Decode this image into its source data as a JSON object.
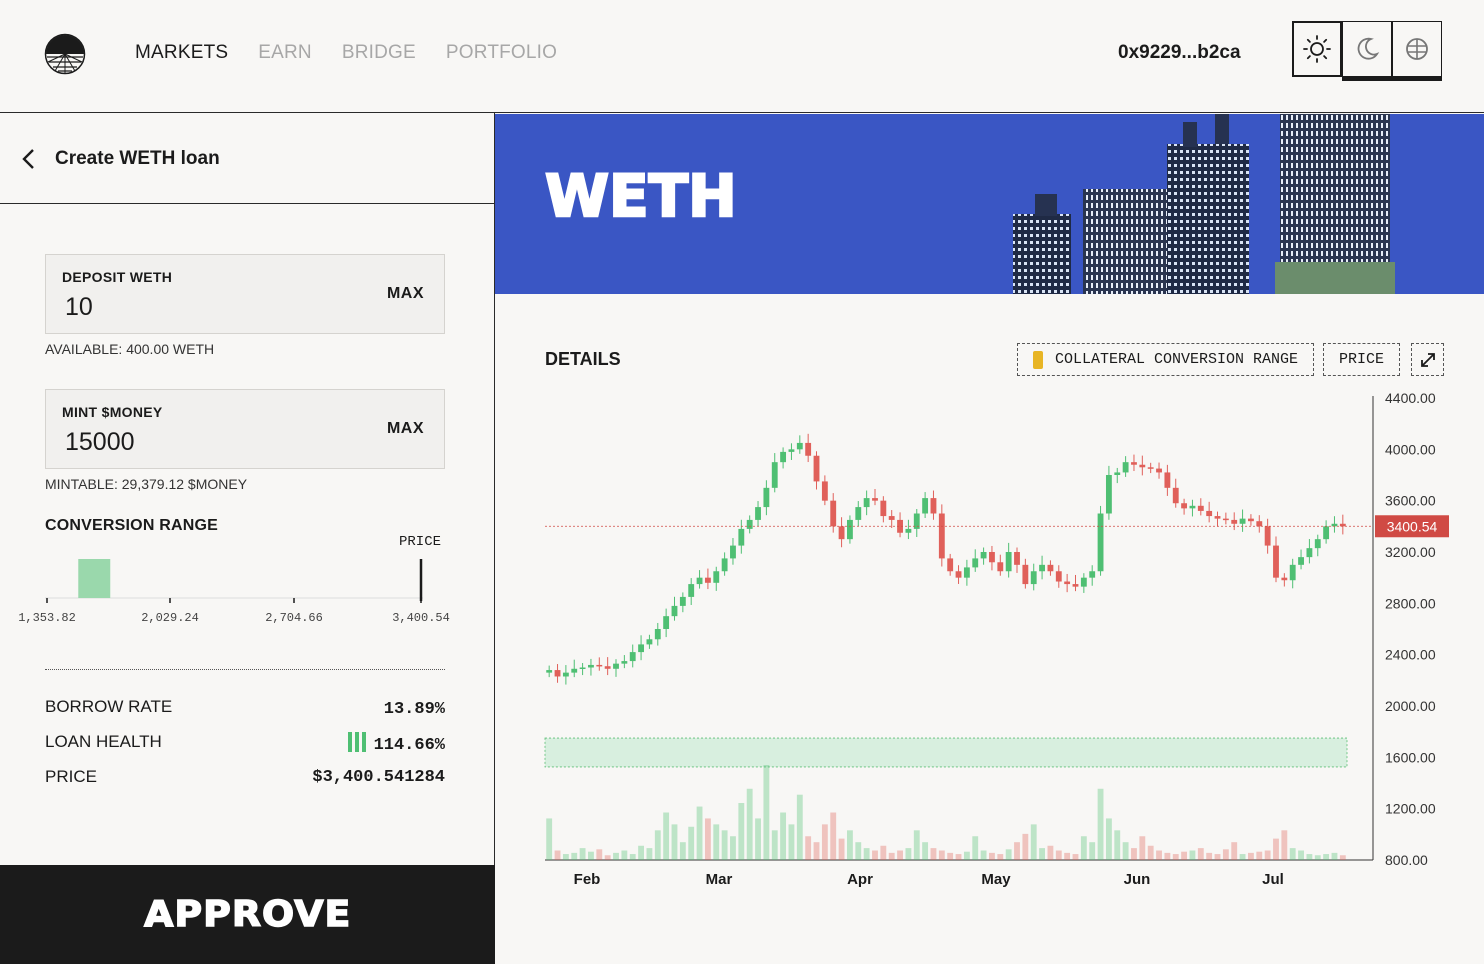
{
  "header": {
    "nav": [
      "MARKETS",
      "EARN",
      "BRIDGE",
      "PORTFOLIO"
    ],
    "active_nav": "MARKETS",
    "wallet": "0x9229...b2ca",
    "theme_icons": [
      "sun-icon",
      "moon-icon",
      "globe-icon"
    ]
  },
  "left": {
    "title": "Create WETH loan",
    "deposit": {
      "label": "DEPOSIT WETH",
      "value": "10",
      "max": "MAX",
      "available": "AVAILABLE: 400.00 WETH"
    },
    "mint": {
      "label": "MINT $MONEY",
      "value": "15000",
      "max": "MAX",
      "mintable": "MINTABLE: 29,379.12 $MONEY"
    },
    "range": {
      "title": "CONVERSION RANGE",
      "price_label": "PRICE",
      "ticks": [
        "1,353.82",
        "2,029.24",
        "2,704.66",
        "3,400.54"
      ],
      "range_start": 1525,
      "range_end": 1700,
      "price": 3400.54,
      "axis_min": 1353.82,
      "axis_max": 3400.54
    },
    "stats": {
      "borrow_rate_label": "BORROW RATE",
      "borrow_rate": "13.89%",
      "loan_health_label": "LOAN HEALTH",
      "loan_health": "114.66%",
      "price_label": "PRICE",
      "price": "$3,400.541284"
    },
    "approve": "APPROVE"
  },
  "banner": {
    "title": "WETH"
  },
  "details": {
    "title": "DETAILS",
    "chip_range": "COLLATERAL CONVERSION RANGE",
    "chip_price": "PRICE"
  },
  "colors": {
    "up": "#4fbf73",
    "down": "#e0605a",
    "banner": "#3a56c4",
    "swatch": "#e8b524",
    "range": "#9ad8ac"
  },
  "chart_data": {
    "type": "candlestick",
    "x_labels": [
      "Feb",
      "Mar",
      "Apr",
      "May",
      "Jun",
      "Jul"
    ],
    "y_ticks": [
      800,
      1200,
      1600,
      2000,
      2400,
      2800,
      3200,
      3600,
      4000,
      4400
    ],
    "ylim": [
      800,
      4400
    ],
    "current_price": 3400.54,
    "current_price_label": "3400.54",
    "collateral_range": [
      1525,
      1750
    ],
    "close_series": [
      2280,
      2230,
      2260,
      2290,
      2300,
      2320,
      2310,
      2290,
      2330,
      2350,
      2420,
      2480,
      2520,
      2600,
      2700,
      2780,
      2850,
      2950,
      3000,
      2960,
      3050,
      3150,
      3250,
      3380,
      3450,
      3550,
      3700,
      3900,
      3980,
      4000,
      4050,
      3950,
      3750,
      3600,
      3400,
      3300,
      3450,
      3550,
      3620,
      3600,
      3480,
      3450,
      3350,
      3380,
      3500,
      3620,
      3500,
      3150,
      3050,
      3000,
      3080,
      3150,
      3200,
      3120,
      3050,
      3200,
      3100,
      2950,
      3050,
      3100,
      3050,
      2970,
      2950,
      2930,
      3000,
      3050,
      3500,
      3800,
      3820,
      3900,
      3880,
      3860,
      3850,
      3820,
      3700,
      3580,
      3540,
      3560,
      3520,
      3480,
      3460,
      3450,
      3420,
      3460,
      3440,
      3400,
      3250,
      3000,
      2980,
      3100,
      3160,
      3230,
      3300,
      3400,
      3420,
      3400
    ],
    "volume_series": [
      35,
      8,
      5,
      6,
      10,
      7,
      9,
      4,
      6,
      8,
      5,
      12,
      10,
      25,
      40,
      30,
      15,
      28,
      45,
      35,
      30,
      25,
      20,
      48,
      60,
      35,
      80,
      25,
      40,
      30,
      55,
      20,
      15,
      30,
      40,
      18,
      25,
      15,
      10,
      8,
      12,
      6,
      8,
      10,
      25,
      15,
      10,
      8,
      6,
      5,
      7,
      20,
      8,
      6,
      5,
      9,
      15,
      22,
      30,
      10,
      12,
      8,
      6,
      5,
      20,
      15,
      60,
      35,
      25,
      15,
      10,
      20,
      12,
      8,
      6,
      5,
      7,
      8,
      10,
      6,
      5,
      9,
      15,
      5,
      6,
      7,
      8,
      18,
      25,
      10,
      8,
      5,
      4,
      5,
      6,
      4
    ]
  }
}
